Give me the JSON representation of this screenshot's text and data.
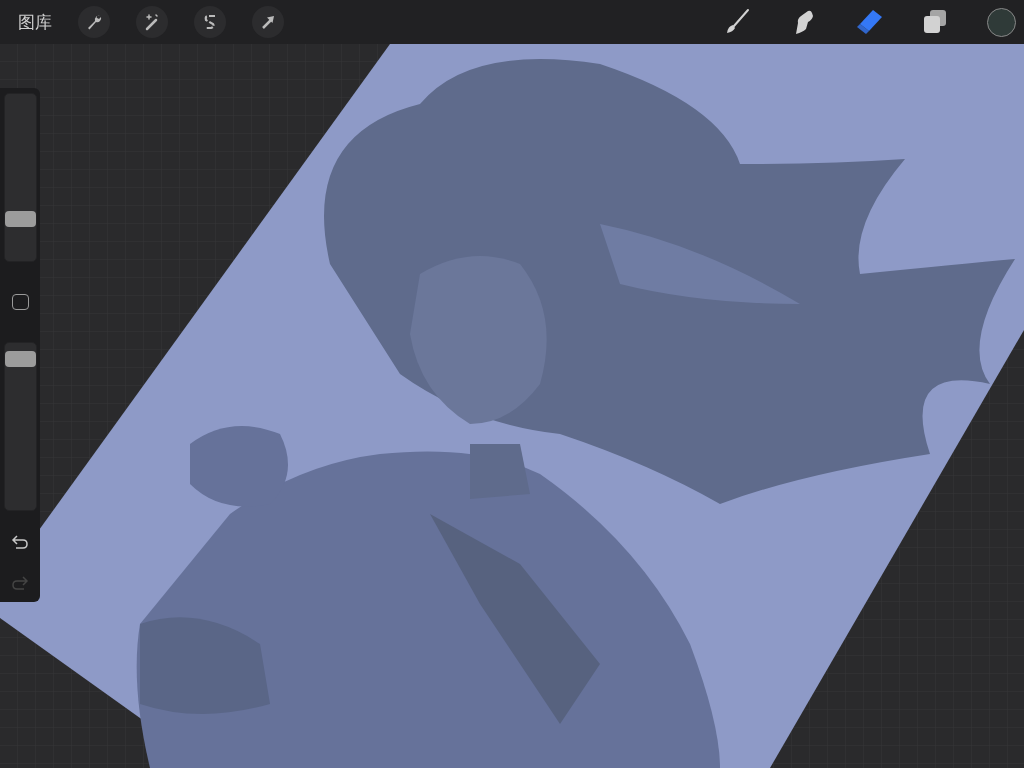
{
  "top_bar": {
    "gallery_label": "图库",
    "action_tools": [
      {
        "kind": "wrench"
      },
      {
        "kind": "wand"
      },
      {
        "kind": "selection"
      },
      {
        "kind": "transform"
      }
    ],
    "paint_tools": [
      {
        "kind": "brush",
        "selected": false
      },
      {
        "kind": "smudge",
        "selected": false
      },
      {
        "kind": "eraser",
        "selected": true
      },
      {
        "kind": "layers",
        "selected": false
      }
    ],
    "color_swatch": {
      "color": "#2f3a38"
    }
  },
  "sidebar": {
    "brush_size": {
      "level": 0.22
    },
    "opacity": {
      "level": 0.95
    },
    "undo": {
      "disabled": false
    },
    "redo": {
      "disabled": true
    }
  }
}
